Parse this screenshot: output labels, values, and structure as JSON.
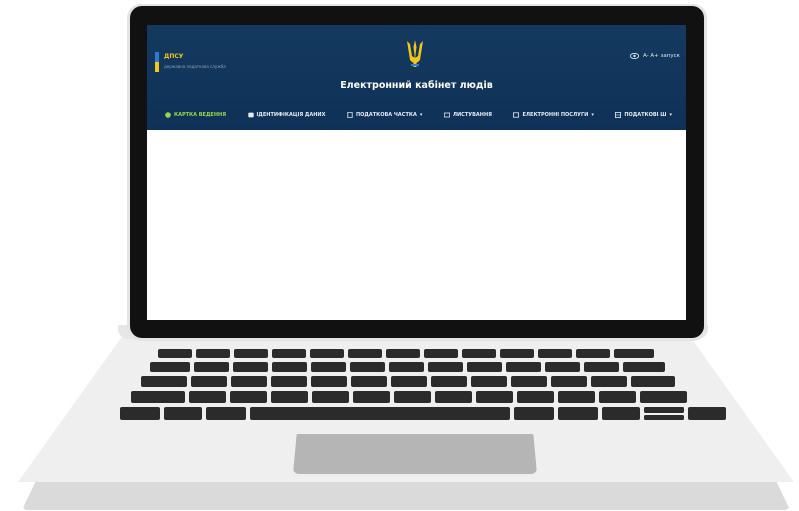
{
  "site": {
    "logo_title": "ДПСУ",
    "logo_subtitle": "державна податкова служба",
    "title": "Електронний кабінет людів",
    "accessibility": "A- A+ запуск"
  },
  "nav": [
    {
      "label": "Картка ведення",
      "icon": "user-circle-icon",
      "active": true
    },
    {
      "label": "Ідентифікація даних",
      "icon": "id-card-icon",
      "active": false
    },
    {
      "label": "Податкова Частка",
      "icon": "document-icon",
      "active": false,
      "dropdown": true
    },
    {
      "label": "Листування",
      "icon": "mail-icon",
      "active": false
    },
    {
      "label": "Електронні Послуги",
      "icon": "service-icon",
      "active": false,
      "dropdown": true
    },
    {
      "label": "Податкові Ш",
      "icon": "grid-icon",
      "active": false,
      "dropdown": true
    }
  ],
  "colors": {
    "header_bg": "#14395f",
    "active_nav": "#9bd64a",
    "flag_blue": "#2e7ad1",
    "flag_yellow": "#f5c518"
  }
}
